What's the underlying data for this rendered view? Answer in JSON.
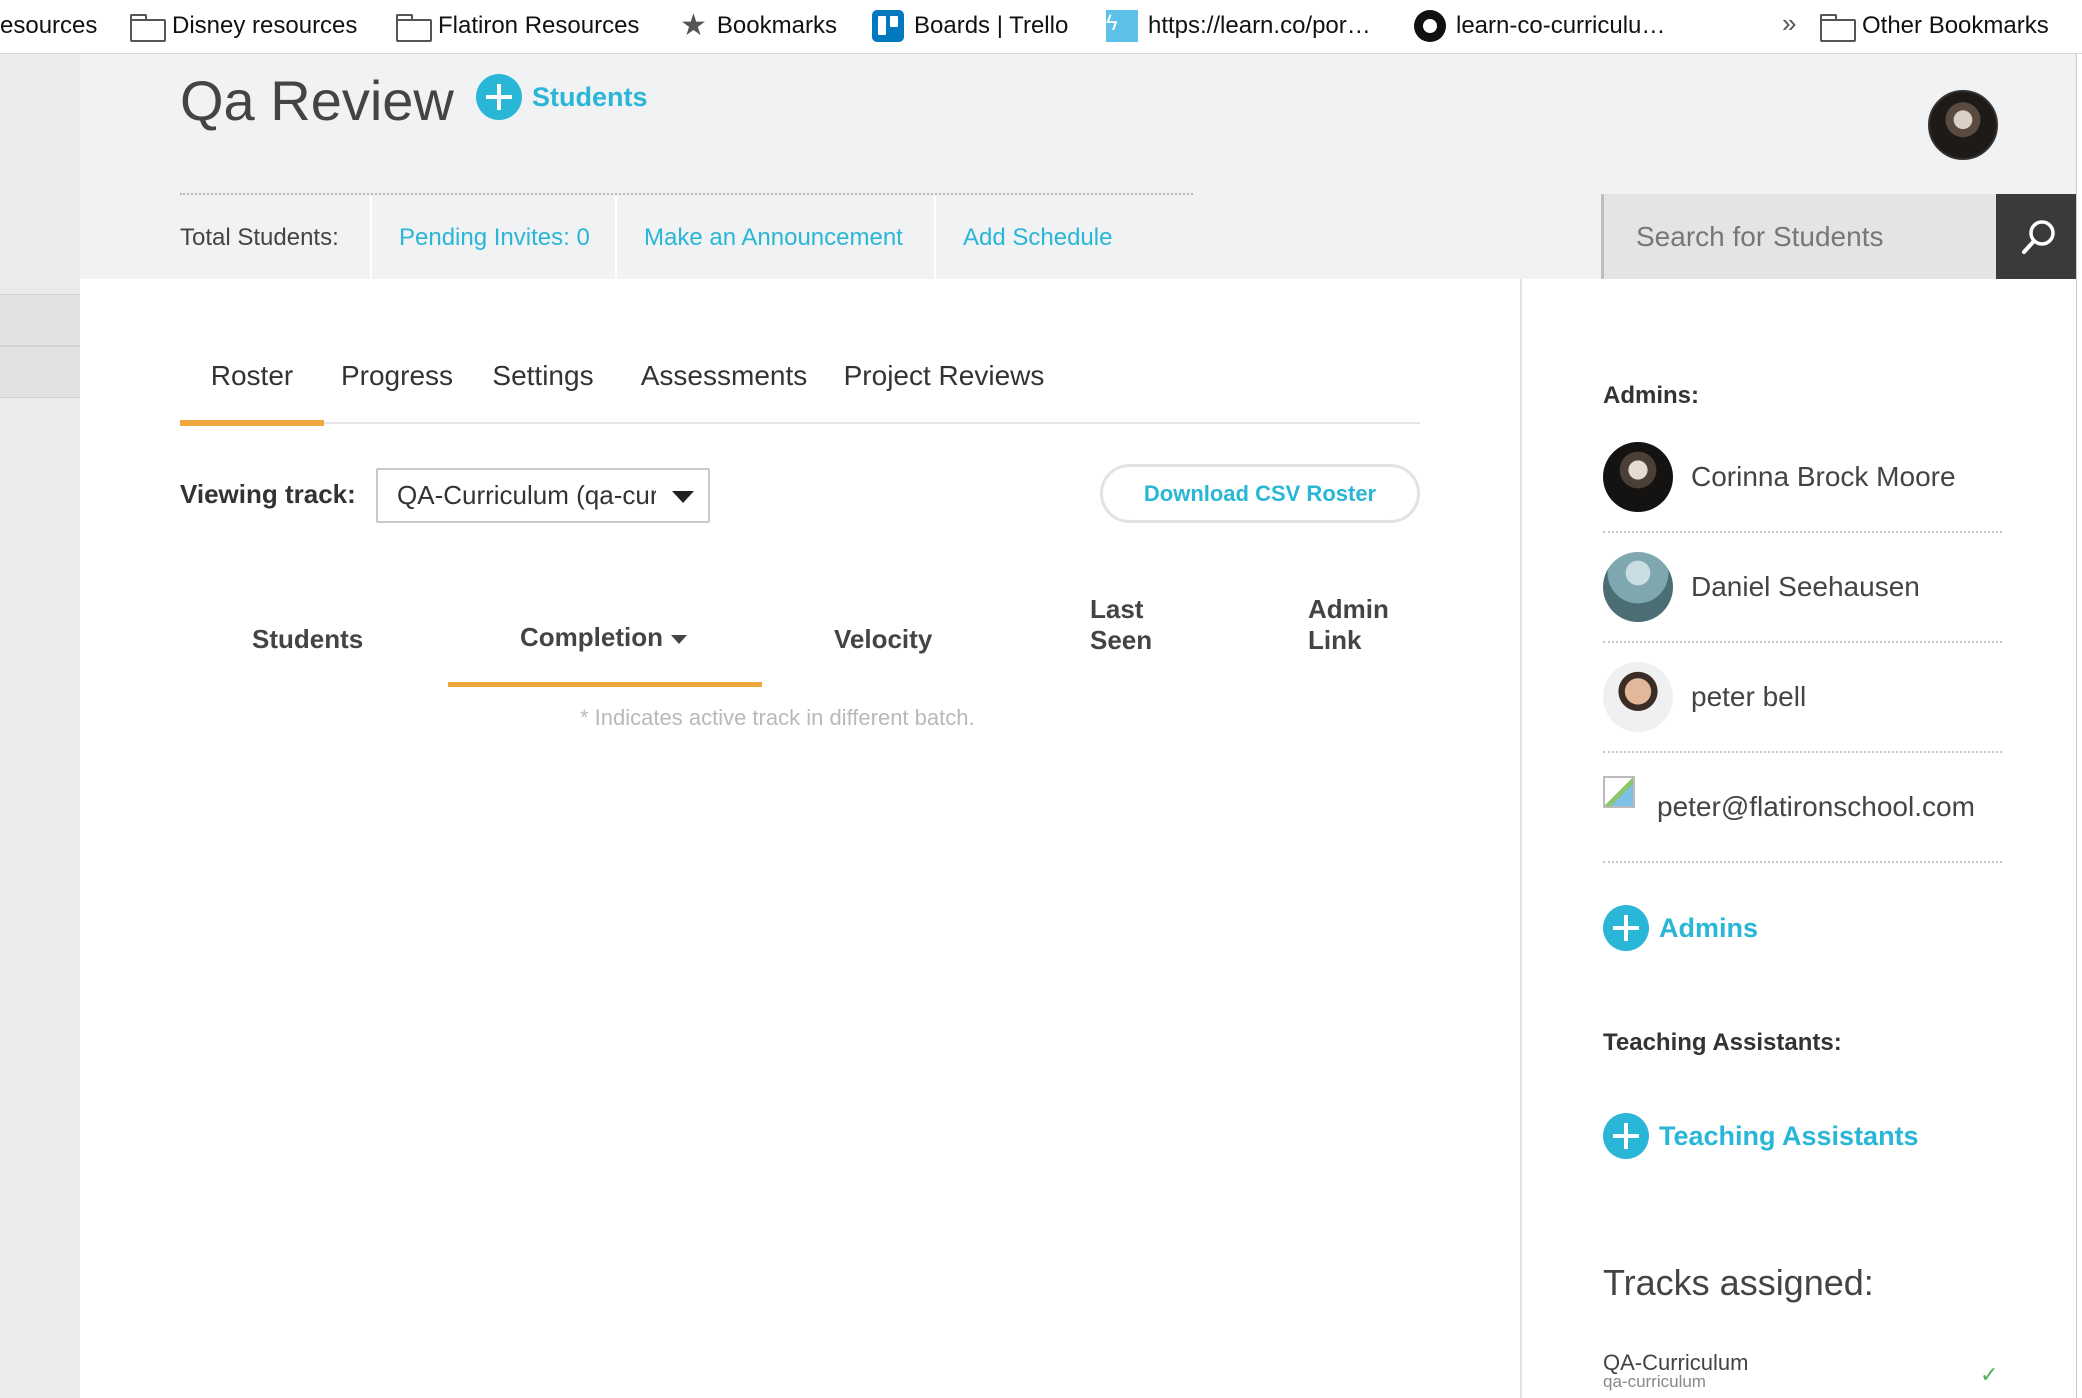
{
  "bookmarks": {
    "items": [
      {
        "label": "esources",
        "icon": "none"
      },
      {
        "label": "Disney resources",
        "icon": "folder-icon"
      },
      {
        "label": "Flatiron Resources",
        "icon": "folder-icon"
      },
      {
        "label": "Bookmarks",
        "icon": "star-icon"
      },
      {
        "label": "Boards | Trello",
        "icon": "trello-icon"
      },
      {
        "label": "https://learn.co/por…",
        "icon": "learn-icon"
      },
      {
        "label": "learn-co-curriculu…",
        "icon": "github-icon"
      }
    ],
    "overflow": "»",
    "other": "Other Bookmarks"
  },
  "header": {
    "title": "Qa Review",
    "add_students": "Students",
    "stats": {
      "total_students": "Total Students:",
      "pending_invites": "Pending Invites: 0",
      "announcement": "Make an Announcement",
      "schedule": "Add Schedule"
    },
    "search_placeholder": "Search for Students"
  },
  "tabs": [
    "Roster",
    "Progress",
    "Settings",
    "Assessments",
    "Project Reviews"
  ],
  "active_tab": "Roster",
  "roster": {
    "viewing_label": "Viewing track:",
    "track_value": "QA-Curriculum (qa-curriculum)",
    "download_csv": "Download CSV Roster",
    "columns": {
      "students": "Students",
      "completion": "Completion",
      "velocity": "Velocity",
      "last_seen_1": "Last",
      "last_seen_2": "Seen",
      "admin_link_1": "Admin",
      "admin_link_2": "Link"
    },
    "note": "* Indicates active track in different batch."
  },
  "sidebar": {
    "admins_heading": "Admins:",
    "admins": [
      {
        "name": "Corinna Brock Moore"
      },
      {
        "name": "Daniel Seehausen"
      },
      {
        "name": "peter bell"
      },
      {
        "name": "peter@flatironschool.com"
      }
    ],
    "add_admins": "Admins",
    "tas_heading": "Teaching Assistants:",
    "add_tas": "Teaching Assistants",
    "tracks_heading": "Tracks assigned:",
    "tracks": [
      {
        "name": "QA-Curriculum",
        "slug": "qa-curriculum",
        "check": "✓"
      }
    ]
  },
  "colors": {
    "accent": "#2ab6d6",
    "tab_underline": "#f0a73d",
    "header_bg": "#f1f2f3"
  }
}
